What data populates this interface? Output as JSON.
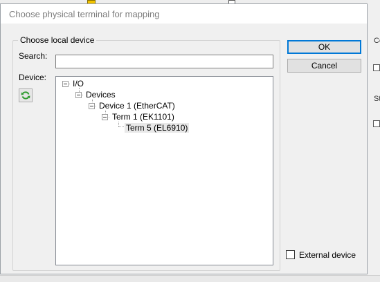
{
  "dialog": {
    "title": "Choose physical terminal for mapping",
    "group_title": "Choose local device",
    "search_label": "Search:",
    "search_value": "",
    "device_label": "Device:",
    "ok_label": "OK",
    "cancel_label": "Cancel",
    "external_device_label": "External device",
    "external_device_checked": false
  },
  "tree": {
    "nodes": [
      {
        "label": "I/O",
        "expanded": true
      },
      {
        "label": "Devices",
        "expanded": true
      },
      {
        "label": "Device 1 (EtherCAT)",
        "expanded": true
      },
      {
        "label": "Term 1 (EK1101)",
        "expanded": true
      },
      {
        "label": "Term 5 (EL6910)",
        "selected": true
      }
    ]
  },
  "background": {
    "partial_label_right": "Co",
    "partial_label_right2": "St"
  },
  "colors": {
    "accent": "#0078d7",
    "refresh_icon": "#2e9b2e",
    "background": "#f0f0f0"
  }
}
